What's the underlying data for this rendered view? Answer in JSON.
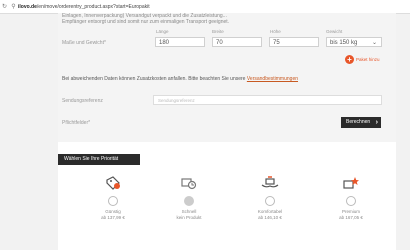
{
  "browser": {
    "url_domain": "ilovo.de",
    "url_path": "/en/move/orderentry_product.aspx?start=Europakit"
  },
  "intro_text_1": "Einlagen, Innenverpackung) Versandgut verpackt und die Zusatzleistung...",
  "intro_text_2": "Empfänger entsorgt und sind somit nur zum einmaligen Transport geeignet.",
  "dimensions": {
    "label": "Maße und Gewicht*",
    "columns": [
      "Länge",
      "Breite",
      "Höhe",
      "Gewicht"
    ],
    "values": [
      "180",
      "70",
      "75",
      "bis 150 kg"
    ],
    "add_label": "Paket hinzu"
  },
  "notice": {
    "text": "Bei abweichenden Daten können Zusatzkosten anfallen. Bitte beachten Sie unsere ",
    "link": "Versandbestimmungen"
  },
  "reference": {
    "label": "Sendungsreferenz",
    "placeholder": "Sendungsreferenz"
  },
  "required_label": "Pflichtfelder*",
  "calculate_button": "Berechnen",
  "priority_title": "Wählen Sie Ihre Priorität",
  "options": [
    {
      "name": "Günstig",
      "price": "ab 137,99 €",
      "icon": "tag-icon",
      "disabled": false
    },
    {
      "name": "Schnell",
      "price": "kein Produkt",
      "icon": "truck-clock-icon",
      "disabled": true
    },
    {
      "name": "Komfortabel",
      "price": "ab 146,10 €",
      "icon": "hand-care-icon",
      "disabled": false
    },
    {
      "name": "Premium",
      "price": "ab 167,05 €",
      "icon": "star-truck-icon",
      "disabled": false
    }
  ],
  "colors": {
    "accent": "#e8562a",
    "dark": "#2b2b2b"
  }
}
